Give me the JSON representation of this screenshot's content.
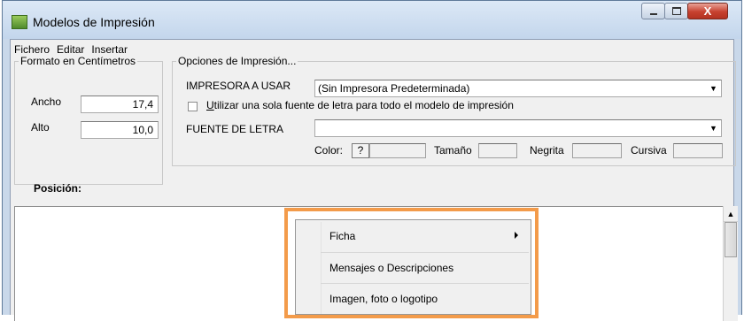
{
  "window": {
    "title": "Modelos de Impresión",
    "app_icon": "table-app-icon",
    "minimize_icon": "minimize-icon",
    "maximize_icon": "maximize-icon",
    "close_glyph": "X"
  },
  "menubar": {
    "items": [
      "Fichero",
      "Editar",
      "Insertar"
    ]
  },
  "formato": {
    "legend": "Formato en Centímetros",
    "ancho_label": "Ancho",
    "ancho_value": "17,4",
    "alto_label": "Alto",
    "alto_value": "10,0"
  },
  "opciones": {
    "legend": "Opciones de Impresión...",
    "impresora_label": "IMPRESORA A USAR",
    "impresora_value": "(Sin Impresora Predeterminada)",
    "checkbox_label": "Utilizar una sola fuente de letra para todo el modelo de impresión",
    "checkbox_checked": false,
    "fuente_label": "FUENTE DE LETRA",
    "fuente_value": "",
    "color_label": "Color:",
    "color_button": "?",
    "tamano_label": "Tamaño",
    "negrita_label": "Negrita",
    "cursiva_label": "Cursiva"
  },
  "posicion": {
    "label": "Posición:"
  },
  "context_menu": {
    "items": [
      {
        "label": "Ficha",
        "has_submenu": true
      },
      {
        "label": "Mensajes o Descripciones",
        "has_submenu": false
      },
      {
        "label": "Imagen, foto o logotipo",
        "has_submenu": false
      }
    ],
    "highlight_color": "#f39b4a"
  },
  "colors": {
    "window_frame": "#c9d8ea",
    "client_bg": "#f0f0f0",
    "close_button": "#c7412f"
  }
}
